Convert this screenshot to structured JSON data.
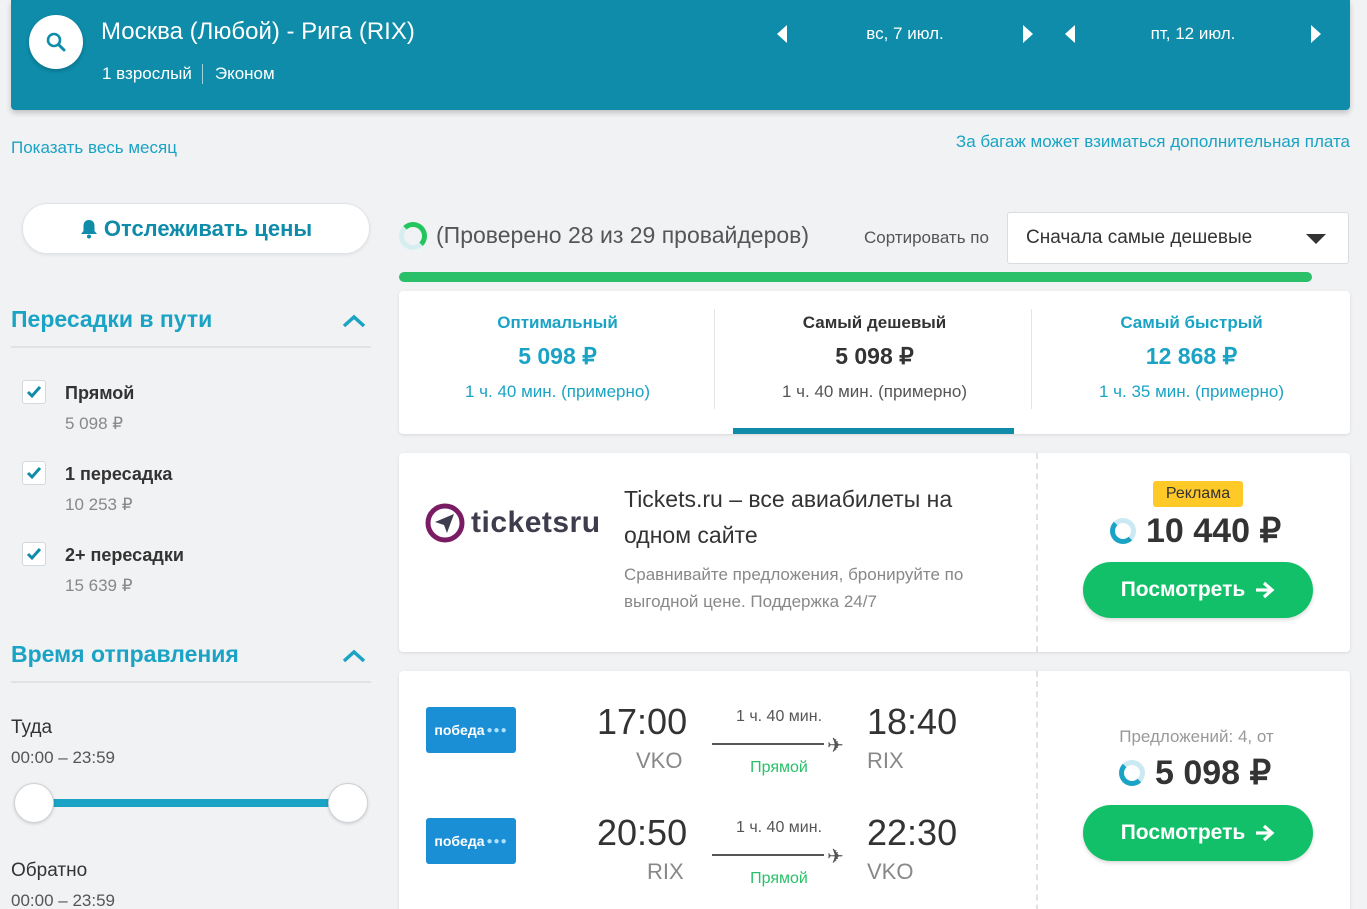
{
  "header": {
    "route": "Москва (Любой) - Рига (RIX)",
    "passengers": "1 взрослый",
    "cabin": "Эконом",
    "depart_date": "вс, 7 июл.",
    "return_date": "пт, 12 июл."
  },
  "links": {
    "show_month": "Показать весь месяц",
    "baggage_note": "За багаж может взиматься дополнительная плата"
  },
  "sidebar": {
    "track_prices": "Отслеживать цены",
    "stops_title": "Пересадки в пути",
    "stops": [
      {
        "label": "Прямой",
        "price": "5 098 ₽",
        "checked": true
      },
      {
        "label": "1 пересадка",
        "price": "10 253 ₽",
        "checked": true
      },
      {
        "label": "2+ пересадки",
        "price": "15 639 ₽",
        "checked": true
      }
    ],
    "departure_title": "Время отправления",
    "outbound_label": "Туда",
    "outbound_range": "00:00 – 23:59",
    "return_label": "Обратно",
    "return_range": "00:00 – 23:59"
  },
  "results": {
    "checked_text": "(Проверено 28 из 29 провайдеров)",
    "sort_label": "Сортировать по",
    "sort_value": "Сначала самые дешевые",
    "tabs": [
      {
        "title": "Оптимальный",
        "price": "5 098 ₽",
        "duration": "1 ч. 40 мин. (примерно)"
      },
      {
        "title": "Самый дешевый",
        "price": "5 098 ₽",
        "duration": "1 ч. 40 мин. (примерно)"
      },
      {
        "title": "Самый быстрый",
        "price": "12 868 ₽",
        "duration": "1 ч. 35 мин. (примерно)"
      }
    ]
  },
  "ad": {
    "logo_text": "ticketsru",
    "title": "Tickets.ru – все авиабилеты на одном сайте",
    "description": "Сравнивайте предложения, бронируйте по выгодной цене. Поддержка 24/7",
    "badge": "Реклама",
    "price": "10 440 ₽",
    "button": "Посмотреть"
  },
  "flight": {
    "airline": "победа",
    "legs": [
      {
        "dep_time": "17:00",
        "dep_code": "VKO",
        "duration": "1 ч. 40 мин.",
        "stops": "Прямой",
        "arr_time": "18:40",
        "arr_code": "RIX"
      },
      {
        "dep_time": "20:50",
        "dep_code": "RIX",
        "duration": "1 ч. 40 мин.",
        "stops": "Прямой",
        "arr_time": "22:30",
        "arr_code": "VKO"
      }
    ],
    "offers": "Предложений: 4, от",
    "price": "5 098 ₽",
    "button": "Посмотреть"
  },
  "colors": {
    "header": "#0e8ca9",
    "accent": "#1aa3c4",
    "cta": "#13c06a",
    "badge": "#ffc928"
  }
}
